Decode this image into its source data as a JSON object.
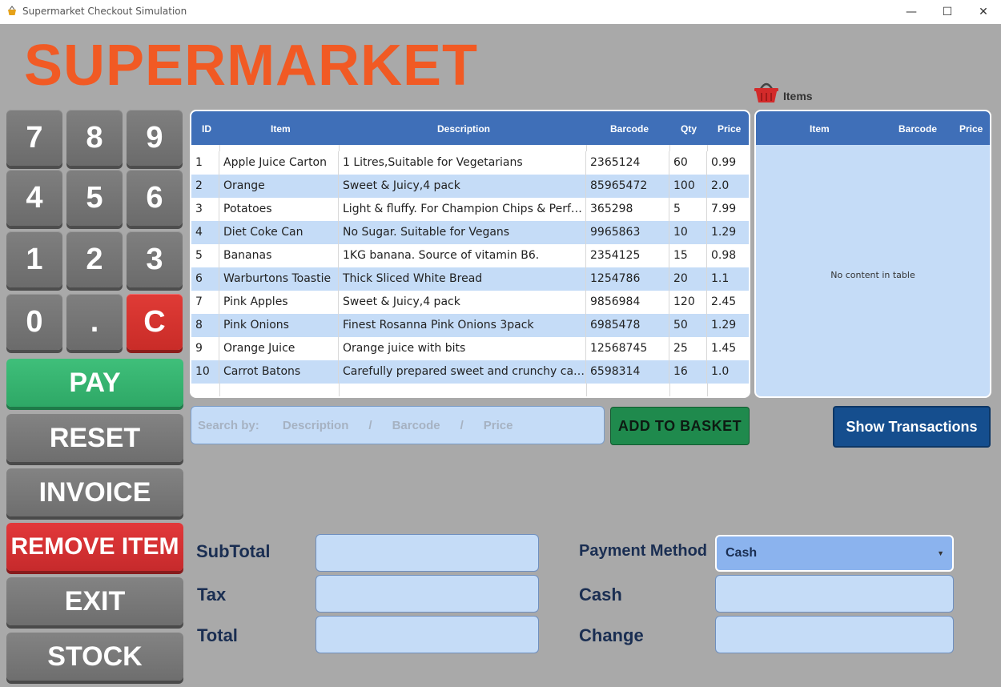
{
  "window": {
    "title": "Supermarket Checkout Simulation",
    "minimize": "—",
    "maximize": "☐",
    "close": "✕"
  },
  "logo": "SUPERMARKET",
  "keypad": {
    "keys": [
      "7",
      "8",
      "9",
      "4",
      "5",
      "6",
      "1",
      "2",
      "3",
      "0",
      ".",
      "C"
    ]
  },
  "actions": {
    "pay": "PAY",
    "reset": "RESET",
    "invoice": "INVOICE",
    "remove_item": "REMOVE ITEM",
    "exit": "EXIT",
    "stock": "STOCK"
  },
  "products_table": {
    "headers": {
      "id": "ID",
      "item": "Item",
      "description": "Description",
      "barcode": "Barcode",
      "qty": "Qty",
      "price": "Price"
    },
    "rows": [
      {
        "id": "1",
        "item": "Apple Juice Carton",
        "description": "1 Litres,Suitable for Vegetarians",
        "barcode": "2365124",
        "qty": "60",
        "price": "0.99"
      },
      {
        "id": "2",
        "item": "Orange",
        "description": "Sweet & Juicy,4 pack",
        "barcode": "85965472",
        "qty": "100",
        "price": "2.0"
      },
      {
        "id": "3",
        "item": "Potatoes",
        "description": "Light & fluffy. For Champion Chips & Perfe...",
        "barcode": "365298",
        "qty": "5",
        "price": "7.99"
      },
      {
        "id": "4",
        "item": "Diet Coke Can",
        "description": "No Sugar. Suitable for Vegans",
        "barcode": "9965863",
        "qty": "10",
        "price": "1.29"
      },
      {
        "id": "5",
        "item": "Bananas",
        "description": " 1KG banana. Source of vitamin B6.",
        "barcode": "2354125",
        "qty": "15",
        "price": "0.98"
      },
      {
        "id": "6",
        "item": "Warburtons Toastie",
        "description": "Thick Sliced White Bread",
        "barcode": "1254786",
        "qty": "20",
        "price": "1.1"
      },
      {
        "id": "7",
        "item": "Pink Apples",
        "description": "Sweet & Juicy,4 pack",
        "barcode": "9856984",
        "qty": "120",
        "price": "2.45"
      },
      {
        "id": "8",
        "item": "Pink Onions",
        "description": "Finest Rosanna Pink Onions 3pack",
        "barcode": "6985478",
        "qty": "50",
        "price": "1.29"
      },
      {
        "id": "9",
        "item": "Orange Juice",
        "description": "Orange juice with bits",
        "barcode": "12568745",
        "qty": "25",
        "price": "1.45"
      },
      {
        "id": "10",
        "item": "Carrot Batons",
        "description": "Carefully prepared sweet and crunchy carrots",
        "barcode": "6598314",
        "qty": "16",
        "price": "1.0"
      }
    ]
  },
  "basket": {
    "label": "Items",
    "headers": {
      "item": "Item",
      "barcode": "Barcode",
      "price": "Price"
    },
    "empty_text": "No content in table"
  },
  "search": {
    "placeholder": "Search by:       Description      /      Barcode      /      Price"
  },
  "add_to_basket": "ADD TO BASKET",
  "show_transactions": "Show Transactions",
  "totals": {
    "subtotal_label": "SubTotal",
    "tax_label": "Tax",
    "total_label": "Total",
    "subtotal_value": "",
    "tax_value": "",
    "total_value": ""
  },
  "payment": {
    "method_label": "Payment Method",
    "method_value": "Cash",
    "cash_label": "Cash",
    "change_label": "Change",
    "cash_value": "",
    "change_value": ""
  },
  "colors": {
    "background": "#a9a9a9",
    "logo": "#f15a24",
    "table_header": "#3f6fb8",
    "row_alt": "#c5dcf7",
    "pay": "#2ea866",
    "danger": "#c92c28",
    "add_to_basket": "#1f8a4d",
    "show_transactions": "#154e8e"
  }
}
